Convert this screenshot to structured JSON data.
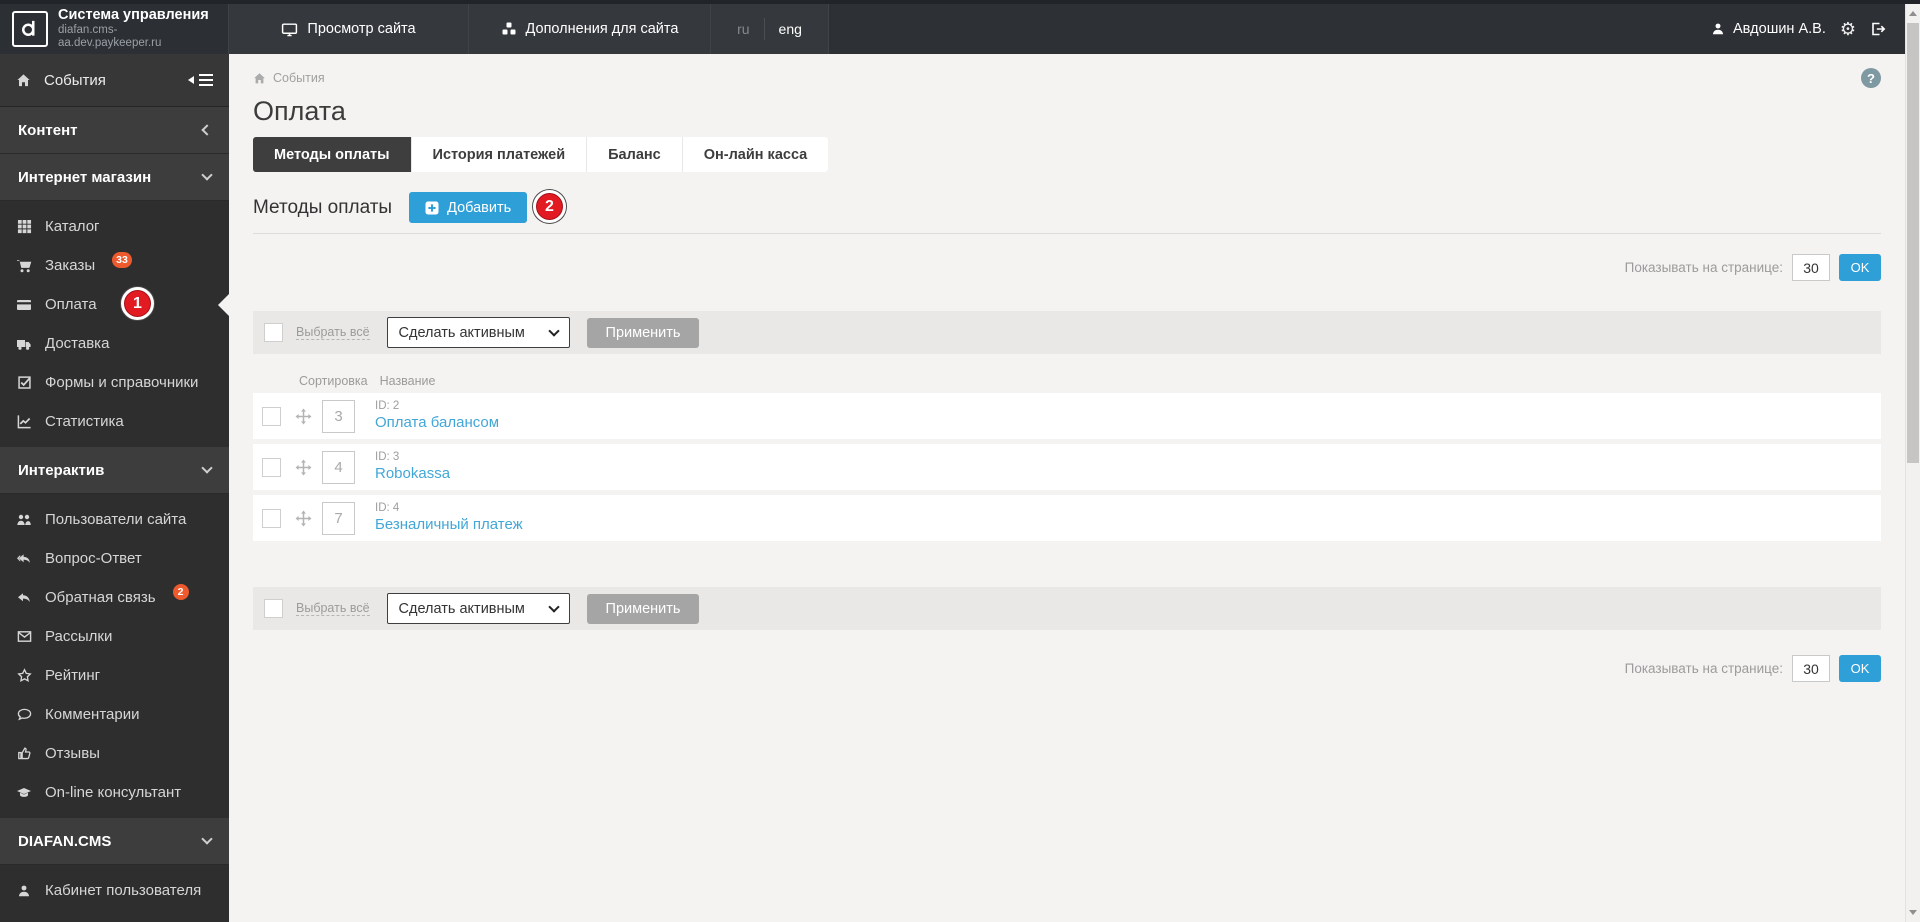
{
  "header": {
    "logo": {
      "title": "Система управления",
      "subtitle": "diafan.cms-aa.dev.paykeeper.ru"
    },
    "nav": [
      {
        "label": "Просмотр сайта"
      },
      {
        "label": "Дополнения для сайта"
      }
    ],
    "languages": {
      "ru": "ru",
      "eng": "eng"
    },
    "user": {
      "name": "Авдошин А.В."
    }
  },
  "sidebar": {
    "items": [
      {
        "label": "События"
      },
      {
        "label": "Контент"
      },
      {
        "label": "Интернет магазин"
      },
      {
        "label": "Каталог"
      },
      {
        "label": "Заказы",
        "badge": "33"
      },
      {
        "label": "Оплата"
      },
      {
        "label": "Доставка"
      },
      {
        "label": "Формы и справочники"
      },
      {
        "label": "Статистика"
      },
      {
        "label": "Интерактив"
      },
      {
        "label": "Пользователи сайта"
      },
      {
        "label": "Вопрос-Ответ"
      },
      {
        "label": "Обратная связь",
        "badge": "2"
      },
      {
        "label": "Рассылки"
      },
      {
        "label": "Рейтинг"
      },
      {
        "label": "Комментарии"
      },
      {
        "label": "Отзывы"
      },
      {
        "label": "On-line консультант"
      },
      {
        "label": "DIAFAN.CMS"
      },
      {
        "label": "Кабинет пользователя"
      }
    ]
  },
  "main": {
    "breadcrumb": "События",
    "help": "?",
    "page_title": "Оплата",
    "tabs": [
      {
        "label": "Методы оплаты",
        "active": true
      },
      {
        "label": "История платежей",
        "active": false
      },
      {
        "label": "Баланс",
        "active": false
      },
      {
        "label": "Он-лайн касса",
        "active": false
      }
    ],
    "section": {
      "title": "Методы оплаты",
      "add_button": "Добавить"
    },
    "per_page": {
      "label": "Показывать на странице:",
      "value": "30",
      "ok": "OK"
    },
    "bulk": {
      "select_all": "Выбрать всё",
      "action": "Сделать активным",
      "apply": "Применить"
    },
    "table": {
      "columns": {
        "sort": "Сортировка",
        "name": "Название"
      },
      "rows": [
        {
          "sort": "3",
          "id": "ID: 2",
          "name": "Оплата балансом"
        },
        {
          "sort": "4",
          "id": "ID: 3",
          "name": "Robokassa"
        },
        {
          "sort": "7",
          "id": "ID: 4",
          "name": "Безналичный платеж"
        }
      ]
    },
    "annotations": [
      {
        "number": "1"
      },
      {
        "number": "2"
      }
    ]
  },
  "colors": {
    "accent_blue": "#2f9fd8",
    "link_blue": "#42a7d7",
    "badge_orange": "#ed5a2d",
    "annotation_red": "#e21b22",
    "header_dark": "#2d3135",
    "sidebar_dark": "#2e2e2e"
  }
}
